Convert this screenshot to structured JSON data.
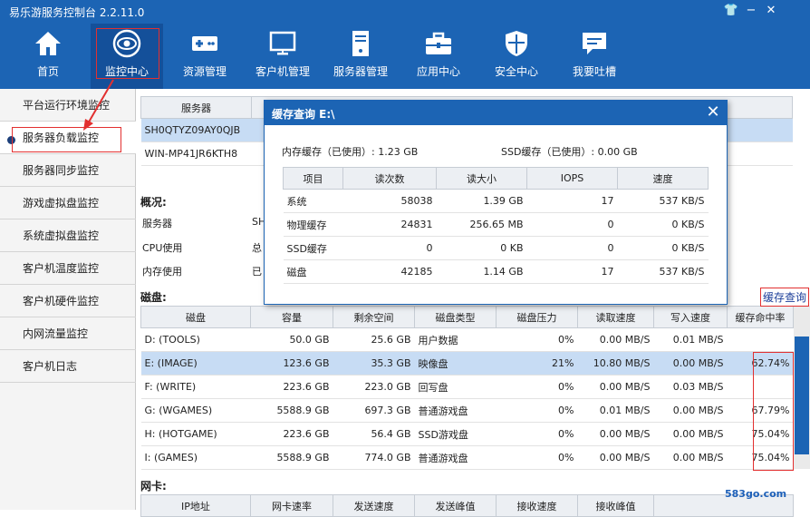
{
  "app": {
    "title": "易乐游服务控制台 2.2.11.0"
  },
  "window_controls": {
    "shirt": "👕",
    "minimize": "−",
    "close": "✕"
  },
  "nav": {
    "items": [
      {
        "label": "首页",
        "icon": "home-icon"
      },
      {
        "label": "监控中心",
        "icon": "eye-icon"
      },
      {
        "label": "资源管理",
        "icon": "gamepad-icon"
      },
      {
        "label": "客户机管理",
        "icon": "monitor-icon"
      },
      {
        "label": "服务器管理",
        "icon": "server-icon"
      },
      {
        "label": "应用中心",
        "icon": "toolbox-icon"
      },
      {
        "label": "安全中心",
        "icon": "shield-icon"
      },
      {
        "label": "我要吐槽",
        "icon": "chat-icon"
      }
    ]
  },
  "sidebar": {
    "items": [
      "平台运行环境监控",
      "服务器负载监控",
      "服务器同步监控",
      "游戏虚拟盘监控",
      "系统虚拟盘监控",
      "客户机温度监控",
      "客户机硬件监控",
      "内网流量监控",
      "客户机日志"
    ]
  },
  "servers": {
    "header": "服务器",
    "rows": [
      "SH0QTYZ09AY0QJB",
      "WIN-MP41JR6KTH8"
    ]
  },
  "overview": {
    "title": "概况:",
    "labels": [
      "服务器",
      "CPU使用",
      "内存使用"
    ],
    "values": [
      "SH",
      "总",
      "已"
    ]
  },
  "disk": {
    "title": "磁盘:",
    "columns": [
      "磁盘",
      "容量",
      "剩余空间",
      "磁盘类型",
      "磁盘压力",
      "读取速度",
      "写入速度",
      "缓存命中率"
    ],
    "rows": [
      [
        "D: (TOOLS)",
        "50.0 GB",
        "25.6 GB",
        "用户数据",
        "0%",
        "0.00 MB/S",
        "0.01 MB/S",
        ""
      ],
      [
        "E: (IMAGE)",
        "123.6 GB",
        "35.3 GB",
        "映像盘",
        "21%",
        "10.80 MB/S",
        "0.00 MB/S",
        "62.74%"
      ],
      [
        "F: (WRITE)",
        "223.6 GB",
        "223.0 GB",
        "回写盘",
        "0%",
        "0.00 MB/S",
        "0.03 MB/S",
        ""
      ],
      [
        "G: (WGAMES)",
        "5588.9 GB",
        "697.3 GB",
        "普通游戏盘",
        "0%",
        "0.01 MB/S",
        "0.00 MB/S",
        "67.79%"
      ],
      [
        "H: (HOTGAME)",
        "223.6 GB",
        "56.4 GB",
        "SSD游戏盘",
        "0%",
        "0.00 MB/S",
        "0.00 MB/S",
        "75.04%"
      ],
      [
        "I: (GAMES)",
        "5588.9 GB",
        "774.0 GB",
        "普通游戏盘",
        "0%",
        "0.00 MB/S",
        "0.00 MB/S",
        "75.04%"
      ]
    ]
  },
  "nic": {
    "title": "网卡:",
    "columns": [
      "IP地址",
      "网卡速率",
      "发送速度",
      "发送峰值",
      "接收速度",
      "接收峰值"
    ]
  },
  "cache_link": "缓存查询",
  "dialog": {
    "title": "缓存查询 E:\\",
    "mem_cache": "内存缓存（已使用）: 1.23 GB",
    "ssd_cache": "SSD缓存（已使用）: 0.00 GB",
    "columns": [
      "项目",
      "读次数",
      "读大小",
      "IOPS",
      "速度"
    ],
    "rows": [
      [
        "系统",
        "58038",
        "1.39 GB",
        "17",
        "537 KB/S"
      ],
      [
        "物理缓存",
        "24831",
        "256.65 MB",
        "0",
        "0 KB/S"
      ],
      [
        "SSD缓存",
        "0",
        "0 KB",
        "0",
        "0 KB/S"
      ],
      [
        "磁盘",
        "42185",
        "1.14 GB",
        "17",
        "537 KB/S"
      ]
    ]
  },
  "watermark": "583go.com",
  "colors": {
    "brand": "#1c64b4",
    "highlight": "#e23030",
    "selected_row": "#c7dcf4"
  }
}
